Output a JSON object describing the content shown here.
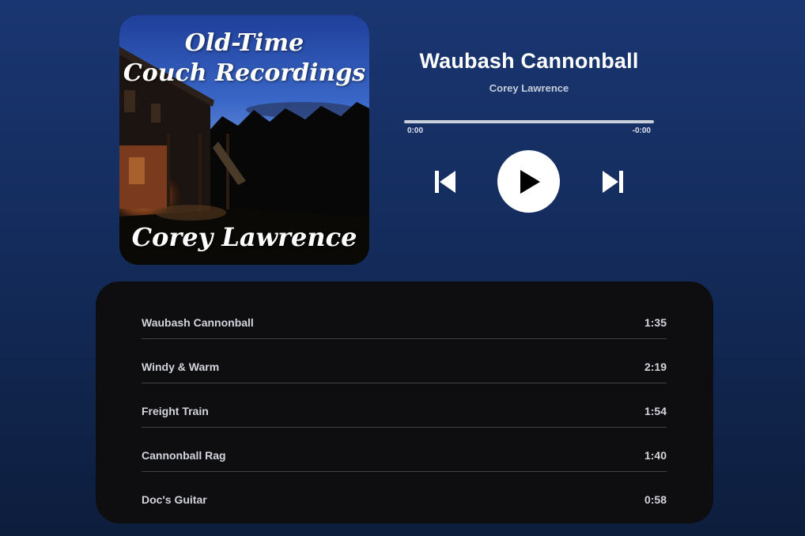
{
  "album": {
    "cover_title_line1": "Old-Time",
    "cover_title_line2": "Couch Recordings",
    "cover_artist": "Corey Lawrence"
  },
  "now_playing": {
    "title": "Waubash Cannonball",
    "artist": "Corey Lawrence",
    "elapsed": "0:00",
    "remaining": "-0:00",
    "progress_fraction": 0
  },
  "controls": {
    "previous_icon": "skip-previous-icon",
    "play_icon": "play-icon",
    "next_icon": "skip-next-icon"
  },
  "tracklist": [
    {
      "name": "Waubash Cannonball",
      "duration": "1:35"
    },
    {
      "name": "Windy & Warm",
      "duration": "2:19"
    },
    {
      "name": "Freight Train",
      "duration": "1:54"
    },
    {
      "name": "Cannonball Rag",
      "duration": "1:40"
    },
    {
      "name": "Doc's Guitar",
      "duration": "0:58"
    }
  ],
  "colors": {
    "background_top": "#1a3672",
    "background_bottom": "#0d1d3c",
    "tracklist_panel": "#0e0e10",
    "play_button": "#ffffff"
  }
}
